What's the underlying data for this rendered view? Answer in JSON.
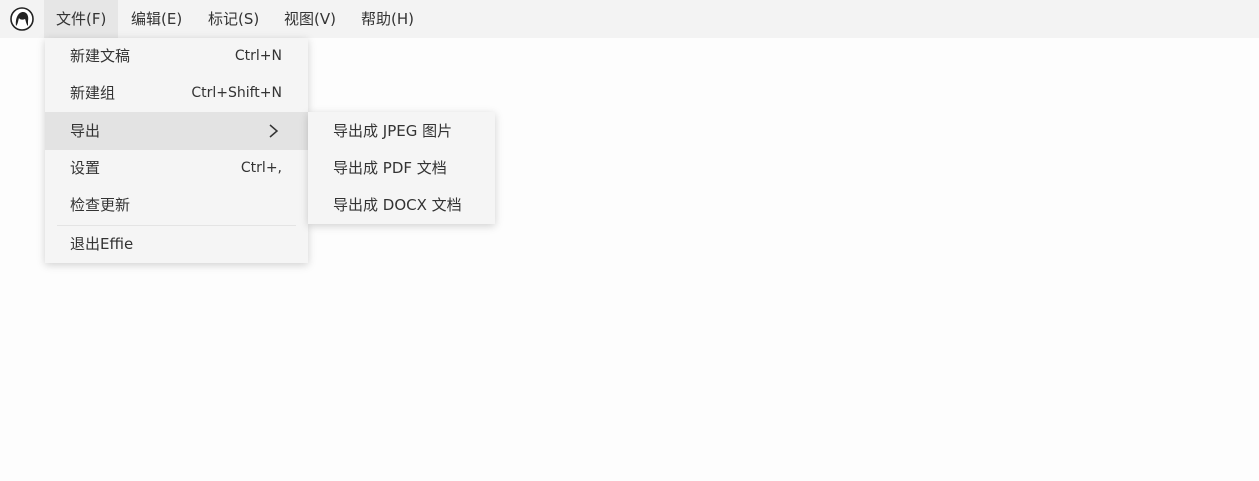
{
  "app": {
    "icon": "girl-face-logo-icon"
  },
  "menubar": {
    "items": [
      {
        "label": "文件(F)"
      },
      {
        "label": "编辑(E)"
      },
      {
        "label": "标记(S)"
      },
      {
        "label": "视图(V)"
      },
      {
        "label": "帮助(H)"
      }
    ],
    "active_index": 0
  },
  "file_menu": {
    "items": [
      {
        "label": "新建文稿",
        "shortcut": "Ctrl+N"
      },
      {
        "label": "新建组",
        "shortcut": "Ctrl+Shift+N"
      },
      {
        "label": "导出",
        "shortcut": "",
        "submenu_icon": "chevron-right-icon"
      },
      {
        "label": "设置",
        "shortcut": "Ctrl+,"
      },
      {
        "label": "检查更新",
        "shortcut": ""
      },
      {
        "label": "退出Effie",
        "shortcut": ""
      }
    ],
    "hover_index": 2
  },
  "export_submenu": {
    "items": [
      {
        "label": "导出成 JPEG 图片"
      },
      {
        "label": "导出成 PDF 文档"
      },
      {
        "label": "导出成 DOCX 文档"
      }
    ]
  }
}
